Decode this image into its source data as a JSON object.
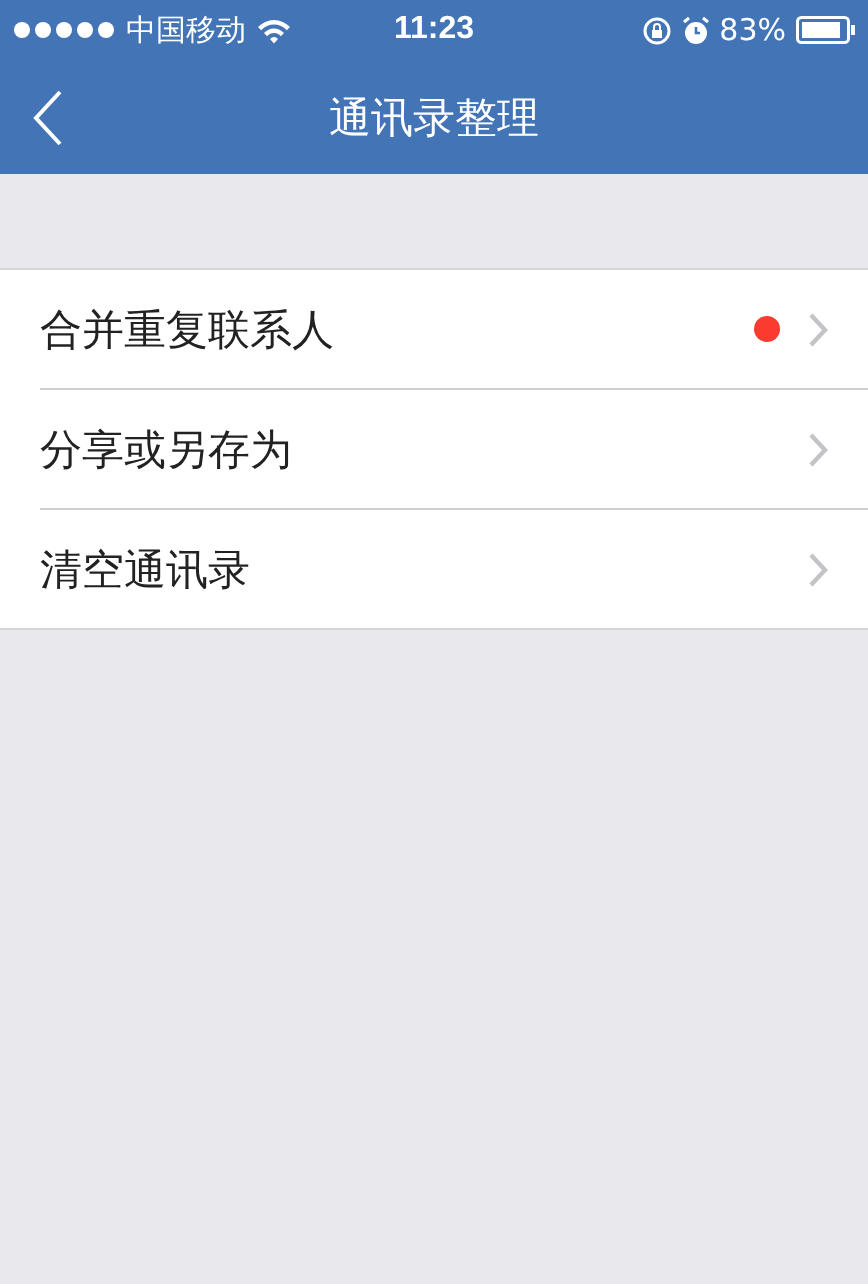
{
  "status_bar": {
    "carrier": "中国移动",
    "time": "11:23",
    "battery": "83%"
  },
  "nav_bar": {
    "title": "通讯录整理"
  },
  "items": [
    {
      "label": "合并重复联系人",
      "badge": true
    },
    {
      "label": "分享或另存为",
      "badge": false
    },
    {
      "label": "清空通讯录",
      "badge": false
    }
  ]
}
